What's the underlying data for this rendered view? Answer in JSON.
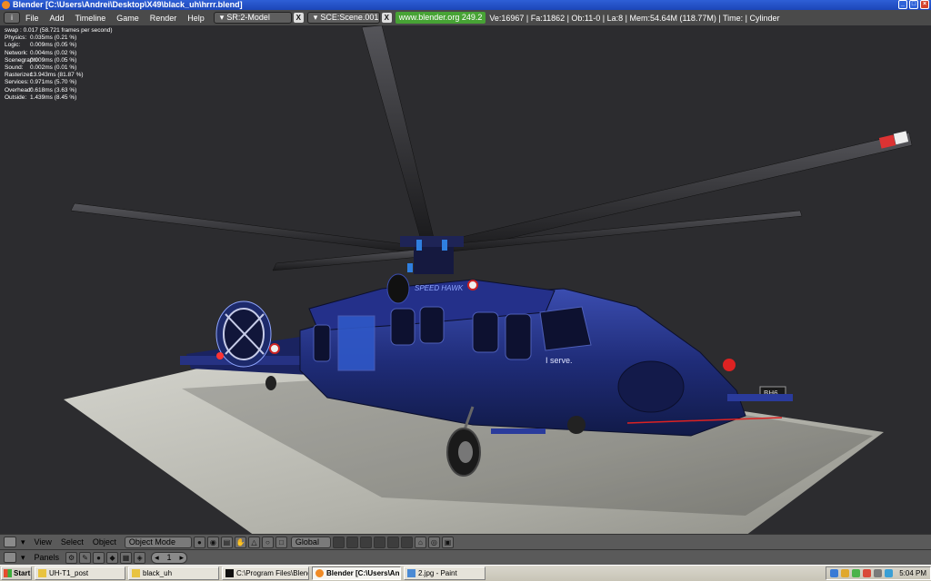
{
  "window": {
    "title": "Blender [C:\\Users\\Andrei\\Desktop\\X49\\black_uh\\hrrr.blend]",
    "controls": {
      "minimize": "_",
      "maximize": "□",
      "close": "×"
    }
  },
  "info_header": {
    "menu": [
      "File",
      "Add",
      "Timeline",
      "Game",
      "Render",
      "Help"
    ],
    "screen": "SR:2-Model",
    "scene": "SCE:Scene.001",
    "close_glyph": "X",
    "url": "www.blender.org 249.2",
    "stats": "Ve:16967 | Fa:11862 | Ob:11-0 | La:8  | Mem:54.64M (118.77M)  | Time:  | Cylinder"
  },
  "profiler": {
    "swap": "swap : 0.017 (58.721 frames per second)",
    "rows": [
      {
        "label": "Physics:",
        "value": "0.035ms (0.21 %)"
      },
      {
        "label": "Logic:",
        "value": "0.009ms (0.05 %)"
      },
      {
        "label": "Network:",
        "value": "0.004ms (0.02 %)"
      },
      {
        "label": "Scenegraph:",
        "value": "0.009ms (0.05 %)"
      },
      {
        "label": "Sound:",
        "value": "0.002ms (0.01 %)"
      },
      {
        "label": "Rasterizer:",
        "value": "13.943ms (81.87 %)"
      },
      {
        "label": "Services:",
        "value": "0.971ms (5.70 %)"
      },
      {
        "label": "Overhead:",
        "value": "0.618ms (3.63 %)"
      },
      {
        "label": "Outside:",
        "value": "1.439ms (8.45 %)"
      }
    ]
  },
  "view_header": {
    "menu": [
      "View",
      "Select",
      "Object"
    ],
    "mode": "Object Mode",
    "orientation": "Global"
  },
  "panels_header": {
    "label": "Panels",
    "frame": "1",
    "arrow_left": "◂",
    "arrow_right": "▸"
  },
  "taskbar": {
    "start": "Start",
    "tasks": [
      {
        "label": "UH-T1_post",
        "active": false
      },
      {
        "label": "black_uh",
        "active": false
      },
      {
        "label": "C:\\Program Files\\Blender...",
        "active": false
      },
      {
        "label": "Blender [C:\\Users\\An...",
        "active": true
      },
      {
        "label": "2.jpg - Paint",
        "active": false
      }
    ],
    "clock": "5:04 PM"
  },
  "helicopter_text": {
    "nose_label": "I serve.",
    "side_label": "SPEED HAWK",
    "tail_number": "BH6"
  },
  "colors": {
    "viewport_bg": "#2c2c2f",
    "fuselage": "#1d2a6b",
    "accent_blue": "#2f7fe0",
    "helipad": "#b8b8b0"
  }
}
